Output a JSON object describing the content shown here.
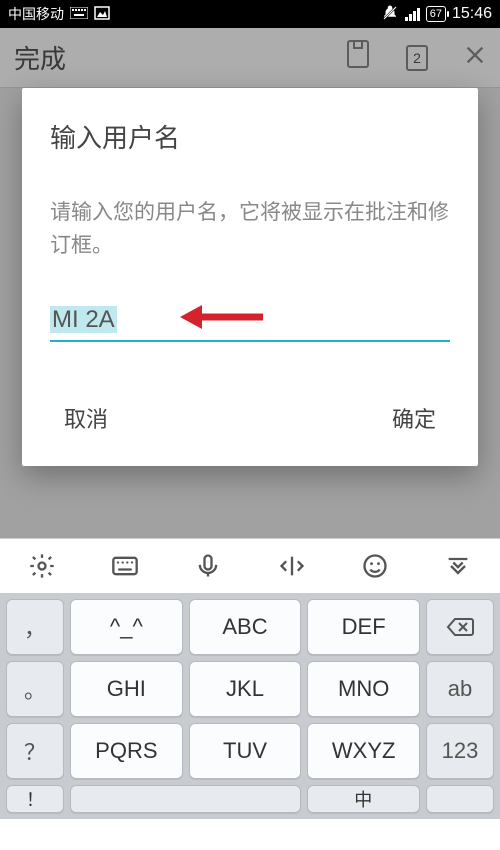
{
  "status": {
    "carrier": "中国移动",
    "battery": "67",
    "time": "15:46"
  },
  "toolbar": {
    "done": "完成",
    "tab_count": "2"
  },
  "dialog": {
    "title": "输入用户名",
    "description": "请输入您的用户名，它将被显示在批注和修订框。",
    "input_value": "MI 2A",
    "cancel": "取消",
    "confirm": "确定"
  },
  "keyboard": {
    "r1": {
      "k1": "，",
      "k2": "^_^",
      "k3": "ABC",
      "k4": "DEF"
    },
    "r2": {
      "k1": "。",
      "k2": "GHI",
      "k3": "JKL",
      "k4": "MNO",
      "k5": "ab"
    },
    "r3": {
      "k1": "？",
      "k2": "PQRS",
      "k3": "TUV",
      "k4": "WXYZ",
      "k5": "123"
    },
    "r4": {
      "k1": "！",
      "k4": "中"
    }
  }
}
